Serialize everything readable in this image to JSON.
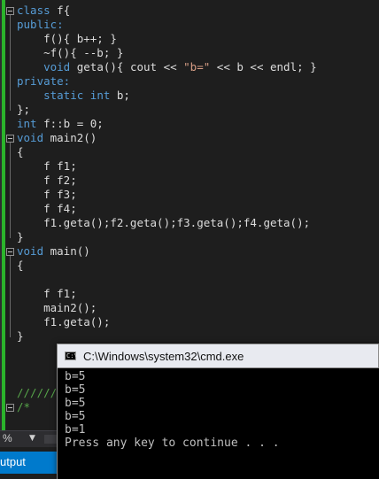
{
  "editor": {
    "lines": [
      [
        {
          "t": "class",
          "c": "kw"
        },
        {
          "t": " f{"
        }
      ],
      [
        {
          "t": "public:",
          "c": "kw"
        }
      ],
      [
        {
          "t": "    f(){ b++; }"
        }
      ],
      [
        {
          "t": "    ~f(){ --b; }"
        }
      ],
      [
        {
          "t": "    "
        },
        {
          "t": "void",
          "c": "kw"
        },
        {
          "t": " geta(){ cout << "
        },
        {
          "t": "\"b=\"",
          "c": "str"
        },
        {
          "t": " << b << endl; }"
        }
      ],
      [
        {
          "t": "private:",
          "c": "kw"
        }
      ],
      [
        {
          "t": "    "
        },
        {
          "t": "static",
          "c": "kw"
        },
        {
          "t": " "
        },
        {
          "t": "int",
          "c": "kw"
        },
        {
          "t": " b;"
        }
      ],
      [
        {
          "t": "};"
        }
      ],
      [
        {
          "t": "int",
          "c": "kw"
        },
        {
          "t": " f::b = 0;"
        }
      ],
      [
        {
          "t": "void",
          "c": "kw"
        },
        {
          "t": " main2()"
        }
      ],
      [
        {
          "t": "{"
        }
      ],
      [
        {
          "t": "    f f1;"
        }
      ],
      [
        {
          "t": "    f f2;"
        }
      ],
      [
        {
          "t": "    f f3;"
        }
      ],
      [
        {
          "t": "    f f4;"
        }
      ],
      [
        {
          "t": "    f1.geta();f2.geta();f3.geta();f4.geta();"
        }
      ],
      [
        {
          "t": "}"
        }
      ],
      [
        {
          "t": "void",
          "c": "kw"
        },
        {
          "t": " main()"
        }
      ],
      [
        {
          "t": "{"
        }
      ],
      [
        {
          "t": ""
        }
      ],
      [
        {
          "t": "    f f1;"
        }
      ],
      [
        {
          "t": "    main2();"
        }
      ],
      [
        {
          "t": "    f1.geta();"
        }
      ],
      [
        {
          "t": "}"
        }
      ],
      [
        {
          "t": ""
        }
      ],
      [
        {
          "t": ""
        }
      ],
      [
        {
          "t": ""
        }
      ],
      [
        {
          "t": "//////",
          "c": "cm"
        }
      ],
      [
        {
          "t": "/*",
          "c": "cm"
        }
      ]
    ]
  },
  "statusbar": {
    "zoom": "% ",
    "zoom_arrow": "▼"
  },
  "output_tab": {
    "label": "utput"
  },
  "cmd": {
    "icon_text": "C:\\",
    "title": "C:\\Windows\\system32\\cmd.exe",
    "output": [
      "b=5",
      "b=5",
      "b=5",
      "b=5",
      "b=1",
      "Press any key to continue . . ."
    ]
  },
  "colors": {
    "keyword": "#569cd6",
    "string": "#d69d85",
    "comment": "#57a64a",
    "change_bar": "#2bb32b",
    "accent": "#007acc"
  }
}
